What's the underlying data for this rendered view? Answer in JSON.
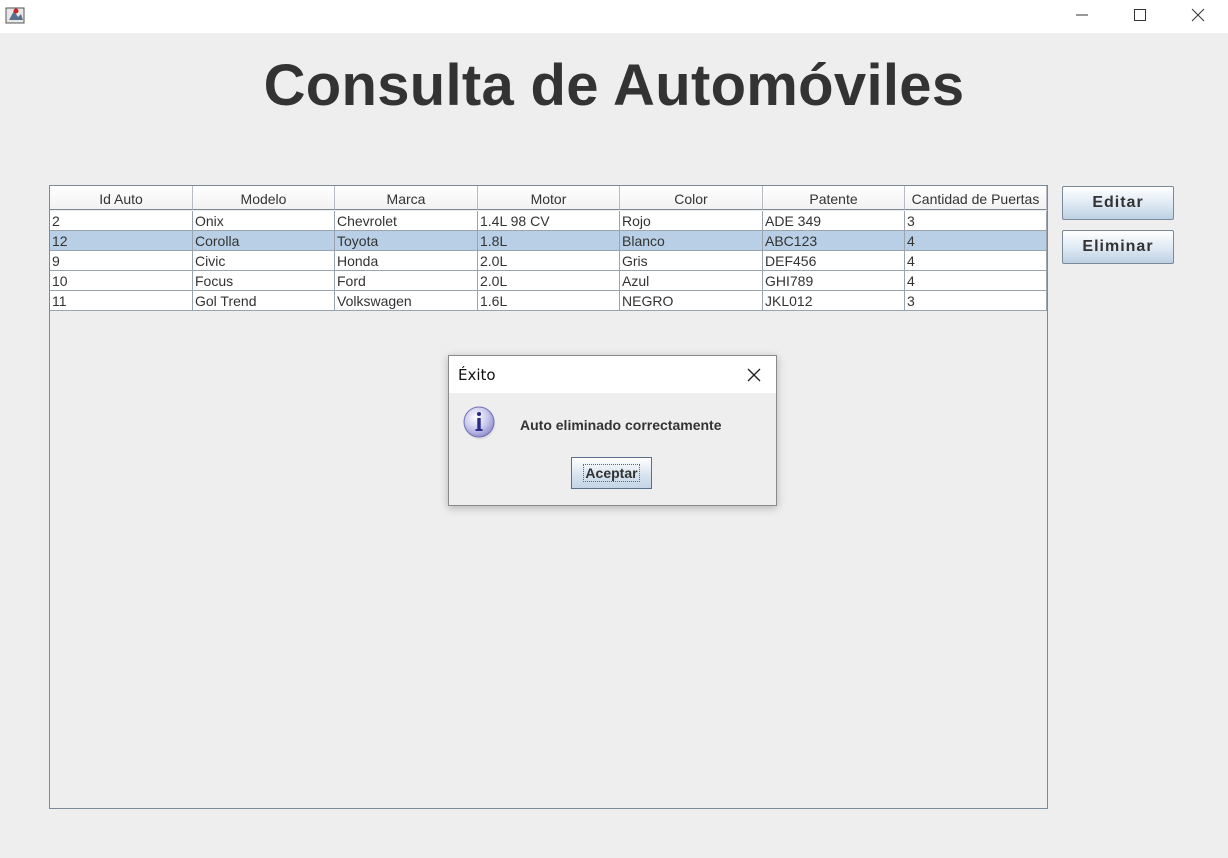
{
  "window": {
    "title_icon": "java-app-icon",
    "controls": [
      "minimize-icon",
      "maximize-icon",
      "close-icon"
    ]
  },
  "page": {
    "title": "Consulta de Automóviles"
  },
  "table": {
    "columns": [
      "Id Auto",
      "Modelo",
      "Marca",
      "Motor",
      "Color",
      "Patente",
      "Cantidad de Puertas"
    ],
    "rows": [
      [
        "2",
        "Onix",
        "Chevrolet",
        "1.4L 98 CV",
        "Rojo",
        "ADE 349",
        "3"
      ],
      [
        "12",
        "Corolla",
        "Toyota",
        "1.8L",
        "Blanco",
        "ABC123",
        "4"
      ],
      [
        "9",
        "Civic",
        "Honda",
        "2.0L",
        "Gris",
        "DEF456",
        "4"
      ],
      [
        "10",
        "Focus",
        "Ford",
        "2.0L",
        "Azul",
        "GHI789",
        "4"
      ],
      [
        "11",
        "Gol Trend",
        "Volkswagen",
        "1.6L",
        "NEGRO",
        "JKL012",
        "3"
      ]
    ],
    "selected_row": 1,
    "selection_color": "#b8cfe5"
  },
  "actions": {
    "edit_label": "Editar",
    "delete_label": "Eliminar"
  },
  "dialog": {
    "title": "Éxito",
    "message": "Auto eliminado correctamente",
    "ok_label": "Aceptar",
    "icon": "info-icon"
  }
}
